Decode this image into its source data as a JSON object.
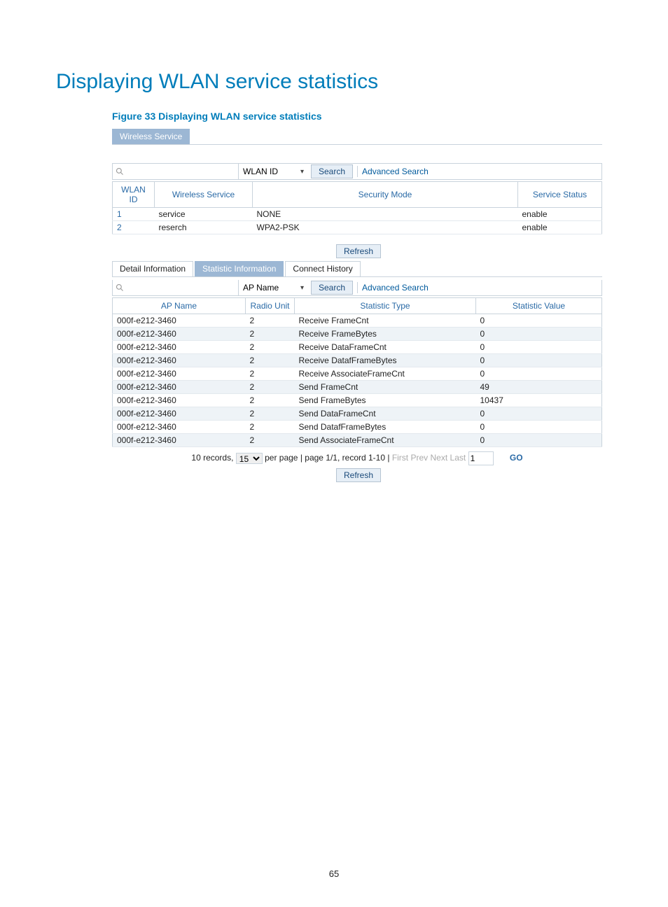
{
  "page": {
    "title": "Displaying WLAN service statistics",
    "figure_caption": "Figure 33 Displaying WLAN service statistics",
    "number": "65"
  },
  "outer_tab": {
    "label": "Wireless Service"
  },
  "search1": {
    "type_selected": "WLAN ID",
    "search_btn": "Search",
    "advanced": "Advanced Search"
  },
  "table1": {
    "headers": [
      "WLAN ID",
      "Wireless Service",
      "Security Mode",
      "Service Status"
    ],
    "rows": [
      {
        "id": "1",
        "service": "service",
        "mode": "NONE",
        "status": "enable"
      },
      {
        "id": "2",
        "service": "reserch",
        "mode": "WPA2-PSK",
        "status": "enable"
      }
    ]
  },
  "refresh_btn": "Refresh",
  "inner_tabs": {
    "detail": "Detail Information",
    "statistic": "Statistic Information",
    "connect": "Connect History"
  },
  "search2": {
    "type_selected": "AP Name",
    "search_btn": "Search",
    "advanced": "Advanced Search"
  },
  "table2": {
    "headers": [
      "AP Name",
      "Radio Unit",
      "Statistic Type",
      "Statistic Value"
    ],
    "rows": [
      {
        "ap": "000f-e212-3460",
        "unit": "2",
        "type": "Receive FrameCnt",
        "val": "0"
      },
      {
        "ap": "000f-e212-3460",
        "unit": "2",
        "type": "Receive FrameBytes",
        "val": "0"
      },
      {
        "ap": "000f-e212-3460",
        "unit": "2",
        "type": "Receive DataFrameCnt",
        "val": "0"
      },
      {
        "ap": "000f-e212-3460",
        "unit": "2",
        "type": "Receive DatafFrameBytes",
        "val": "0"
      },
      {
        "ap": "000f-e212-3460",
        "unit": "2",
        "type": "Receive AssociateFrameCnt",
        "val": "0"
      },
      {
        "ap": "000f-e212-3460",
        "unit": "2",
        "type": "Send FrameCnt",
        "val": "49"
      },
      {
        "ap": "000f-e212-3460",
        "unit": "2",
        "type": "Send FrameBytes",
        "val": "10437"
      },
      {
        "ap": "000f-e212-3460",
        "unit": "2",
        "type": "Send DataFrameCnt",
        "val": "0"
      },
      {
        "ap": "000f-e212-3460",
        "unit": "2",
        "type": "Send DatafFrameBytes",
        "val": "0"
      },
      {
        "ap": "000f-e212-3460",
        "unit": "2",
        "type": "Send AssociateFrameCnt",
        "val": "0"
      }
    ]
  },
  "pager": {
    "records_prefix": "10 records,",
    "per_page_value": "15",
    "mid": "per page | page 1/1, record 1-10 |",
    "first": "First",
    "prev": "Prev",
    "next": "Next",
    "last": "Last",
    "goto_value": "1",
    "go": "GO"
  }
}
